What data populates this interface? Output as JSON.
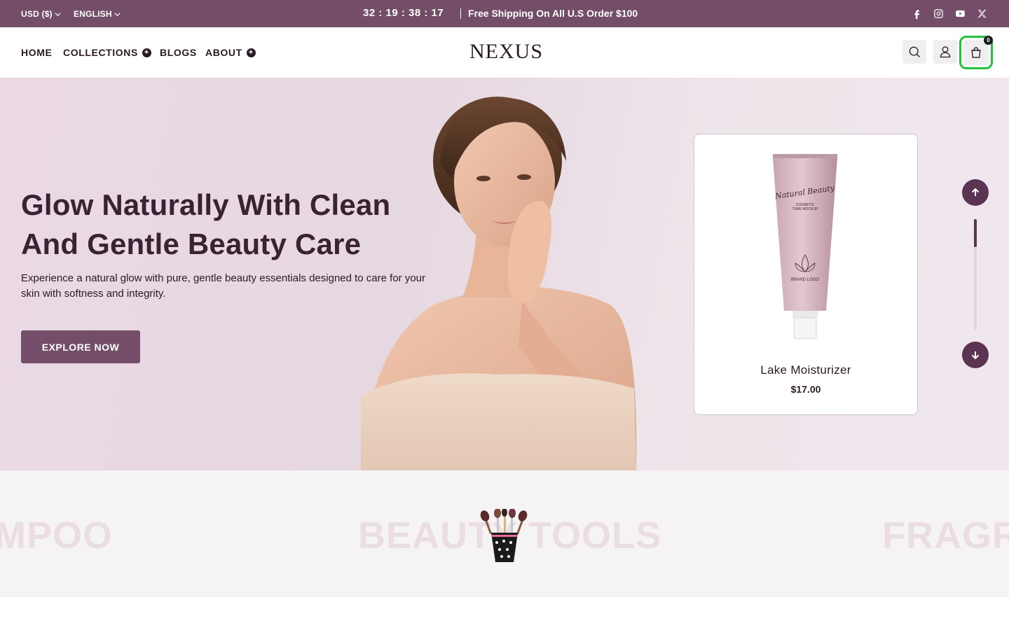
{
  "topbar": {
    "currency": "USD ($)",
    "language": "ENGLISH",
    "countdown": "32 : 19 : 38 : 17",
    "promo": "Free Shipping On All U.S Order $100",
    "social_icons": [
      "facebook-icon",
      "instagram-icon",
      "youtube-icon",
      "x-icon"
    ]
  },
  "header": {
    "nav": [
      "HOME",
      "COLLECTIONS",
      "BLOGS",
      "ABOUT"
    ],
    "logo": "NEXUS",
    "cart_count": "0"
  },
  "hero": {
    "title_line1": "Glow Naturally With Clean",
    "title_line2": "And Gentle Beauty Care",
    "description": "Experience a natural glow with pure, gentle beauty essentials designed to care for your skin with softness and integrity.",
    "cta": "EXPLORE NOW",
    "product": {
      "name": "Lake Moisturizer",
      "price": "$17.00",
      "tube_script": "Natural Beauty",
      "tube_sub1": "COSMETIC",
      "tube_sub2": "TUBE MOCKUP",
      "tube_brand": "BRAND LOGO"
    }
  },
  "marquee": {
    "words": [
      "MPOO",
      "BEAUTY TOOLS",
      "FRAGR"
    ]
  },
  "colors": {
    "brand": "#744d68",
    "accent_dark": "#5a3450",
    "cart_highlight": "#22c23a"
  }
}
